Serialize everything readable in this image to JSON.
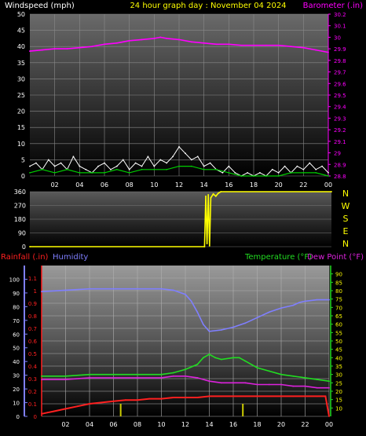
{
  "header": {
    "wind_label": "Windspeed (mph)",
    "title": "24 hour graph day : November 04 2024",
    "baro_label": "Barometer (.in)"
  },
  "colors": {
    "background": "#000000",
    "wind_gust": "#ffffff",
    "wind_avg": "#00cc00",
    "barometer": "#ff00ff",
    "title": "#ffff00",
    "direction": "#ffff00",
    "rain": "#ff2020",
    "humidity": "#7f7fff",
    "temperature": "#22dd22",
    "dewpoint": "#dd22dd",
    "rain_bars": "#cccc00"
  },
  "direction_panel": {
    "compass_labels": [
      "N",
      "W",
      "S",
      "E",
      "N"
    ]
  },
  "bottom_header": {
    "rain_label": "Rainfall (.in)",
    "humidity_label": "Humidity",
    "temp_label": "Temperature (°F)",
    "dew_label": "Dew Point (°F)"
  },
  "chart_data": [
    {
      "type": "line",
      "panel": "wind_barometer",
      "xticks": [
        "02",
        "04",
        "06",
        "08",
        "10",
        "12",
        "14",
        "16",
        "18",
        "20",
        "22",
        "00"
      ],
      "xlim_hours": [
        0,
        24
      ],
      "y_left": {
        "label": "Windspeed (mph)",
        "ylim": [
          0,
          50
        ],
        "ticks": [
          "0",
          "5",
          "10",
          "15",
          "20",
          "25",
          "30",
          "35",
          "40",
          "45",
          "50"
        ]
      },
      "y_right": {
        "label": "Barometer (.in)",
        "ylim": [
          28.8,
          30.2
        ],
        "ticks": [
          "28.8",
          "28.9",
          "29",
          "29.1",
          "29.2",
          "29.3",
          "29.4",
          "29.5",
          "29.6",
          "29.7",
          "29.8",
          "29.9",
          "30",
          "30.1",
          "30.2"
        ]
      },
      "grid": true,
      "series": [
        {
          "name": "Barometer (.in)",
          "axis": "right",
          "x": [
            0,
            1,
            2,
            3,
            4,
            5,
            6,
            7,
            8,
            9,
            10,
            10.5,
            11,
            12,
            13,
            14,
            15,
            16,
            17,
            18,
            19,
            20,
            21,
            22,
            23,
            24
          ],
          "y": [
            29.88,
            29.89,
            29.9,
            29.9,
            29.91,
            29.92,
            29.94,
            29.95,
            29.97,
            29.98,
            29.99,
            30.0,
            29.99,
            29.98,
            29.96,
            29.95,
            29.94,
            29.94,
            29.93,
            29.93,
            29.93,
            29.93,
            29.92,
            29.91,
            29.89,
            29.87
          ]
        },
        {
          "name": "Gust",
          "axis": "left",
          "x": [
            0,
            0.5,
            1,
            1.5,
            2,
            2.5,
            3,
            3.5,
            4,
            4.5,
            5,
            5.5,
            6,
            6.5,
            7,
            7.5,
            8,
            8.5,
            9,
            9.5,
            10,
            10.5,
            11,
            11.5,
            12,
            12.5,
            13,
            13.5,
            14,
            14.5,
            15,
            15.5,
            16,
            16.5,
            17,
            17.5,
            18,
            18.5,
            19,
            19.5,
            20,
            20.5,
            21,
            21.5,
            22,
            22.5,
            23,
            23.5,
            24
          ],
          "y": [
            3,
            4,
            2,
            5,
            3,
            4,
            2,
            6,
            3,
            2,
            1,
            3,
            4,
            2,
            3,
            5,
            2,
            4,
            3,
            6,
            3,
            5,
            4,
            6,
            9,
            7,
            5,
            6,
            3,
            4,
            2,
            1,
            3,
            1,
            0,
            1,
            0,
            1,
            0,
            2,
            1,
            3,
            1,
            3,
            2,
            4,
            2,
            3,
            1
          ]
        },
        {
          "name": "Average",
          "axis": "left",
          "x": [
            0,
            1,
            2,
            3,
            4,
            5,
            6,
            7,
            8,
            9,
            10,
            11,
            12,
            13,
            14,
            15,
            16,
            17,
            18,
            19,
            20,
            21,
            22,
            23,
            24
          ],
          "y": [
            1,
            2,
            1,
            2,
            1,
            1,
            1,
            2,
            1,
            2,
            2,
            2,
            3,
            3,
            2,
            2,
            1,
            0,
            0,
            0,
            0,
            1,
            1,
            1,
            0
          ]
        }
      ]
    },
    {
      "type": "line",
      "panel": "wind_direction",
      "ylim": [
        0,
        360
      ],
      "yticks": [
        "0",
        "90",
        "180",
        "270",
        "360"
      ],
      "series": [
        {
          "name": "Wind Direction",
          "x": [
            0,
            13.9,
            14.0,
            14.1,
            14.2,
            14.3,
            14.4,
            14.6,
            14.8,
            15.0,
            15.2,
            24
          ],
          "y": [
            0,
            0,
            330,
            20,
            340,
            5,
            320,
            345,
            330,
            350,
            360,
            360
          ]
        }
      ]
    },
    {
      "type": "line",
      "panel": "rain_humidity_temperature",
      "xticks": [
        "02",
        "04",
        "06",
        "08",
        "10",
        "12",
        "14",
        "16",
        "18",
        "20",
        "22",
        "00"
      ],
      "xlim_hours": [
        0,
        24
      ],
      "y_rain": {
        "label": "Rainfall (.in)",
        "ylim": [
          0,
          1.2
        ],
        "ticks": [
          "0",
          "0.1",
          "0.2",
          "0.3",
          "0.4",
          "0.5",
          "0.6",
          "0.7",
          "0.8",
          "0.9",
          "1",
          "1.1"
        ]
      },
      "y_humidity": {
        "label": "Humidity",
        "ylim": [
          0,
          110
        ],
        "ticks": [
          "0",
          "10",
          "20",
          "30",
          "40",
          "50",
          "60",
          "70",
          "80",
          "90",
          "100"
        ]
      },
      "y_temp": {
        "label": "Temperature (°F)",
        "ylim": [
          5,
          95
        ],
        "ticks": [
          "10",
          "15",
          "20",
          "25",
          "30",
          "35",
          "40",
          "45",
          "50",
          "55",
          "60",
          "65",
          "70",
          "75",
          "80",
          "85",
          "90"
        ]
      },
      "grid": true,
      "series": [
        {
          "name": "Humidity",
          "axis": "humidity",
          "x": [
            0,
            2,
            4,
            6,
            8,
            10,
            11,
            12,
            12.5,
            13,
            13.5,
            14,
            15,
            16,
            17,
            18,
            19,
            20,
            21,
            21.5,
            22,
            23,
            24
          ],
          "y": [
            91,
            92,
            93,
            93,
            93,
            93,
            92,
            89,
            84,
            76,
            67,
            62,
            63,
            65,
            68,
            72,
            76,
            79,
            81,
            83,
            84,
            85,
            85
          ]
        },
        {
          "name": "Temperature (°F)",
          "axis": "temp",
          "x": [
            0,
            2,
            4,
            6,
            8,
            10,
            11,
            12,
            13,
            13.5,
            14,
            14.5,
            15,
            16,
            16.5,
            17,
            18,
            19,
            20,
            21,
            22,
            23,
            24
          ],
          "y": [
            29,
            29,
            30,
            30,
            30,
            30,
            31,
            33,
            36,
            40,
            42,
            40,
            39,
            40,
            40,
            38,
            34,
            32,
            30,
            29,
            28,
            27,
            26
          ]
        },
        {
          "name": "Dew Point (°F)",
          "axis": "temp",
          "x": [
            0,
            2,
            4,
            6,
            8,
            10,
            11,
            12,
            13,
            14,
            15,
            16,
            17,
            18,
            19,
            20,
            21,
            22,
            23,
            24
          ],
          "y": [
            27,
            27,
            28,
            28,
            28,
            28,
            29,
            29,
            28,
            26,
            25,
            25,
            25,
            24,
            24,
            24,
            23,
            23,
            22,
            22
          ]
        },
        {
          "name": "Rainfall (.in)",
          "axis": "rain",
          "x": [
            0,
            0.5,
            1,
            2,
            3,
            4,
            5,
            6,
            7,
            8,
            9,
            10,
            11,
            12,
            13,
            14,
            15,
            16,
            17,
            18,
            19,
            20,
            21,
            22,
            23,
            23.7,
            24
          ],
          "y": [
            0.02,
            0.03,
            0.04,
            0.06,
            0.08,
            0.1,
            0.11,
            0.12,
            0.13,
            0.13,
            0.14,
            0.14,
            0.15,
            0.15,
            0.15,
            0.16,
            0.16,
            0.16,
            0.16,
            0.16,
            0.16,
            0.16,
            0.16,
            0.16,
            0.16,
            0.16,
            0.0
          ]
        },
        {
          "name": "Rain rate",
          "axis": "rain",
          "type": "bar",
          "x": [
            6.6,
            16.8
          ],
          "y": [
            0.1,
            0.1
          ]
        }
      ]
    }
  ]
}
